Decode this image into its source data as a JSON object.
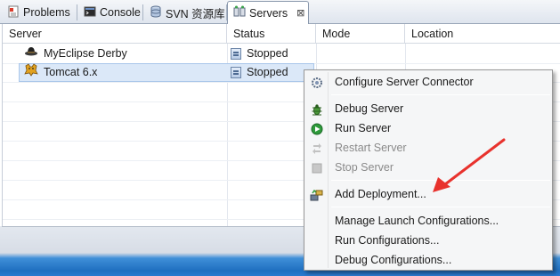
{
  "tabs": [
    {
      "label": "Problems",
      "icon": "problems-icon"
    },
    {
      "label": "Console",
      "icon": "console-icon"
    },
    {
      "label": "SVN 资源库",
      "icon": "svn-repository-icon"
    },
    {
      "label": "Servers",
      "icon": "servers-icon",
      "close": "⊠"
    }
  ],
  "table": {
    "columns": [
      "Server",
      "Status",
      "Mode",
      "Location"
    ],
    "rows": [
      {
        "server": "MyEclipse Derby",
        "status": "Stopped",
        "mode": "",
        "location": "",
        "icon": "derby-server-icon"
      },
      {
        "server": "Tomcat  6.x",
        "status": "Stopped",
        "mode": "",
        "location": "",
        "icon": "tomcat-server-icon"
      }
    ],
    "selected_row": 1
  },
  "context_menu": {
    "items": [
      {
        "label": "Configure Server Connector",
        "icon": "configure-connector-icon",
        "enabled": true
      },
      {
        "label": "Debug Server",
        "icon": "debug-icon",
        "enabled": true
      },
      {
        "label": "Run Server",
        "icon": "run-icon",
        "enabled": true
      },
      {
        "label": "Restart Server",
        "icon": "restart-icon",
        "enabled": false
      },
      {
        "label": "Stop Server",
        "icon": "stop-icon",
        "enabled": false
      },
      {
        "label": "Add Deployment...",
        "icon": "add-deployment-icon",
        "enabled": true
      },
      {
        "label": "Manage Launch Configurations...",
        "icon": "",
        "enabled": true
      },
      {
        "label": "Run Configurations...",
        "icon": "",
        "enabled": true
      },
      {
        "label": "Debug Configurations...",
        "icon": "",
        "enabled": true
      }
    ]
  },
  "annotation": {
    "color": "#e8322d"
  },
  "colors": {
    "selection": "#dbe8f8",
    "menu_background": "#f5f6f7",
    "disabled_text": "#8a8a8a"
  }
}
